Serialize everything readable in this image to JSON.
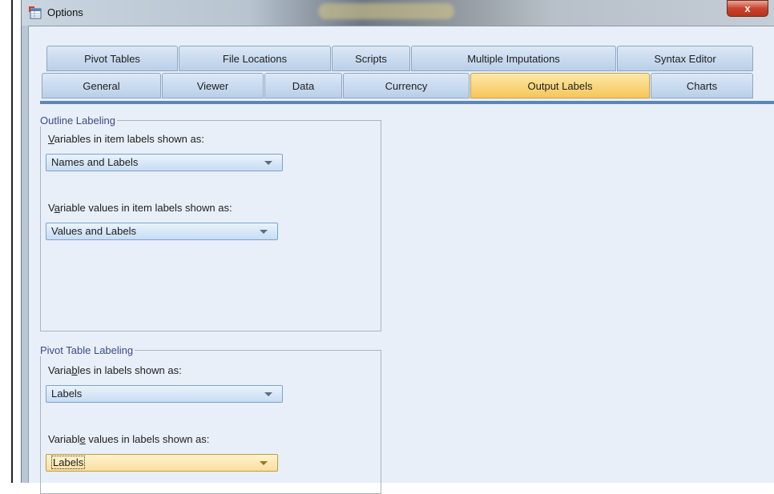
{
  "window": {
    "title": "Options",
    "close_glyph": "x"
  },
  "tabs_row1": [
    "Pivot Tables",
    "File Locations",
    "Scripts",
    "Multiple Imputations",
    "Syntax Editor"
  ],
  "tabs_row2": [
    "General",
    "Viewer",
    "Data",
    "Currency",
    "Output Labels",
    "Charts"
  ],
  "active_tab": "Output Labels",
  "outline_labeling": {
    "title": "Outline Labeling",
    "variables_label_prefix": "",
    "variables_label_mnemonic": "V",
    "variables_label_rest": "ariables in item labels shown as:",
    "variables_value": "Names and Labels",
    "values_label_prefix": "V",
    "values_label_mnemonic": "a",
    "values_label_rest": "riable values in item labels shown as:",
    "values_value": "Values and Labels"
  },
  "pivot_labeling": {
    "title": "Pivot Table Labeling",
    "variables_label_prefix": "Varia",
    "variables_label_mnemonic": "b",
    "variables_label_rest": "les in labels shown as:",
    "variables_value": "Labels",
    "values_label_prefix": "Variabl",
    "values_label_mnemonic": "e",
    "values_label_rest": " values in labels shown as:",
    "values_value": "Labels"
  },
  "colors": {
    "active_tab": "#f6c65a",
    "tab": "#c4d7ed",
    "client_bg": "#e8eff8",
    "group_title": "#3a4a8a"
  }
}
